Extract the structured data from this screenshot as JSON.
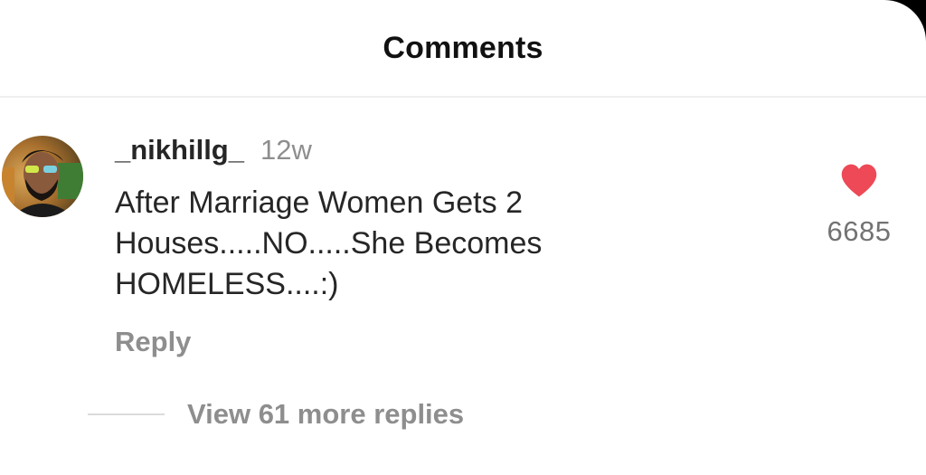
{
  "header": {
    "title": "Comments"
  },
  "comment": {
    "username": "_nikhillg_",
    "timestamp": "12w",
    "text": "After Marriage Women Gets 2 Houses.....NO.....She Becomes HOMELESS....:)",
    "avatar_icon": "profile-photo",
    "like_icon": "heart-icon",
    "like_count": "6685",
    "liked": true,
    "reply_label": "Reply",
    "view_replies_label": "View 61 more replies"
  },
  "colors": {
    "background": "#ffffff",
    "text": "#262626",
    "secondary_text": "#8e8e8e",
    "like_red": "#ed4956",
    "divider": "#dbdbdb"
  }
}
